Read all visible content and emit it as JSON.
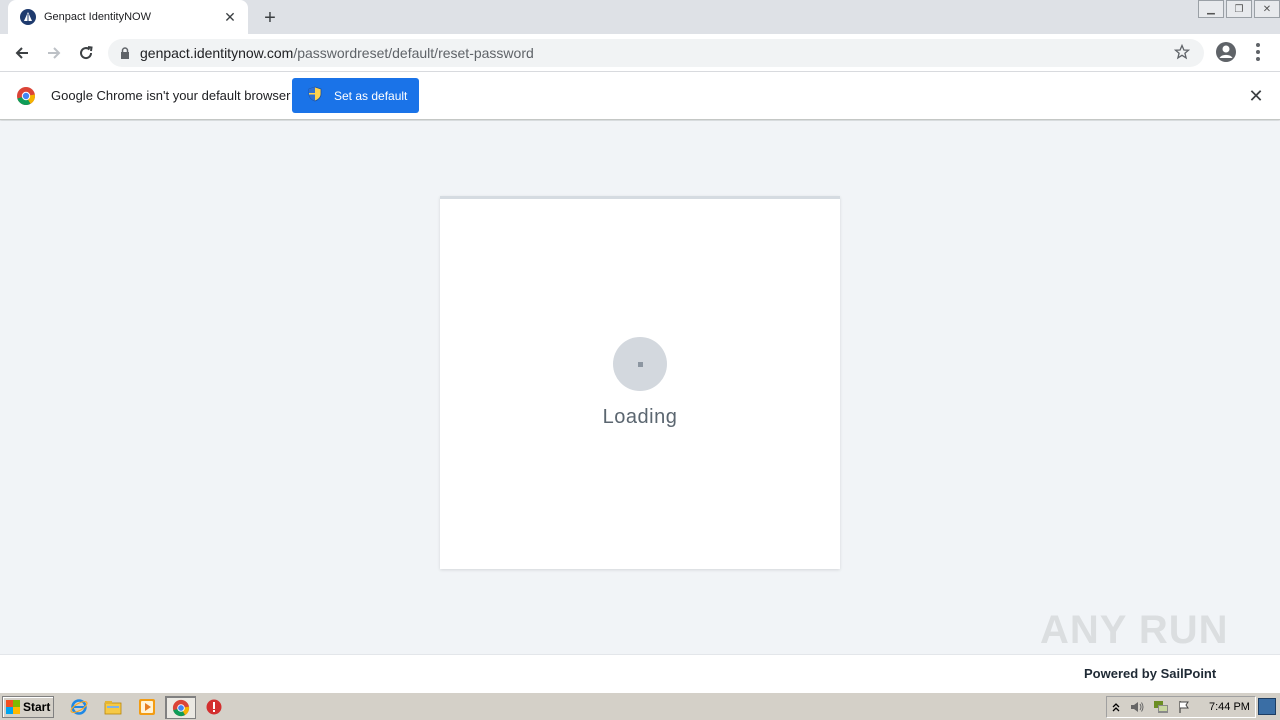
{
  "browser": {
    "tab_title": "Genpact IdentityNOW",
    "new_tab_glyph": "+",
    "url_host": "genpact.identitynow.com",
    "url_path": "/passwordreset/default/reset-password"
  },
  "infobar": {
    "message": "Google Chrome isn't your default browser",
    "set_default_label": "Set as default"
  },
  "page": {
    "loading_text": "Loading",
    "powered_by": "Powered by SailPoint"
  },
  "watermark": "ANY RUN",
  "taskbar": {
    "start_label": "Start",
    "clock": "7:44 PM"
  },
  "colors": {
    "accent": "#1a73e8",
    "page_bg": "#f1f4f7",
    "spinner": "#d3d8de"
  },
  "icons": [
    "back-arrow-icon",
    "forward-arrow-icon",
    "reload-icon",
    "lock-icon",
    "star-icon",
    "profile-icon",
    "menu-icon",
    "chrome-logo-icon",
    "shield-icon",
    "close-icon"
  ]
}
